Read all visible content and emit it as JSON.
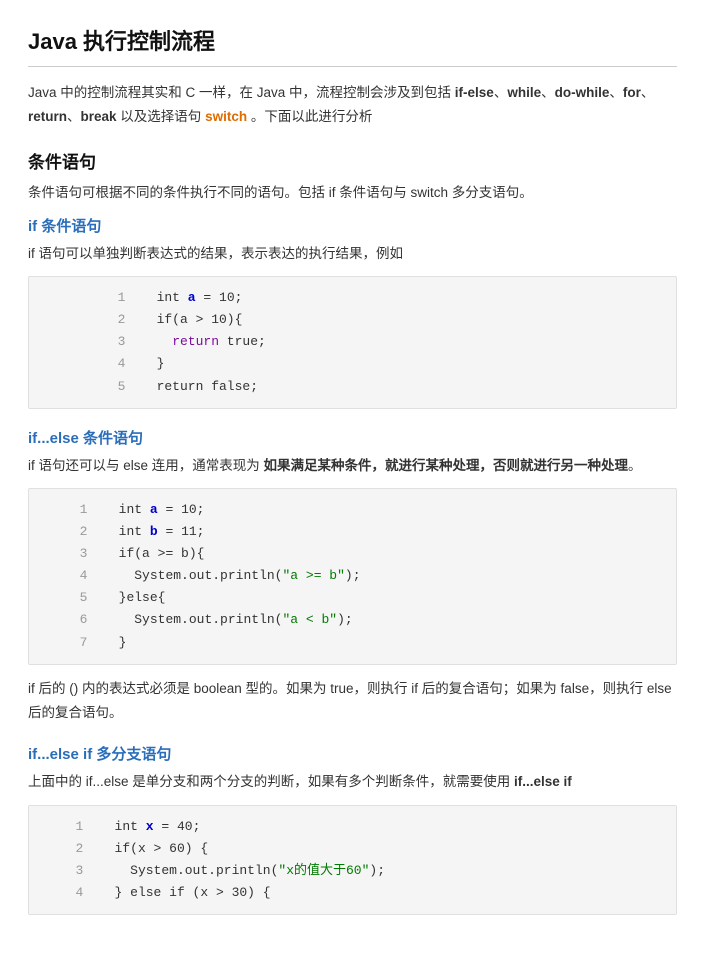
{
  "page": {
    "title": "Java 执行控制流程",
    "intro": {
      "text_parts": [
        {
          "text": "Java 中的控制流程其实和 C 一样，在 Java 中，流程控制会涉及到包括 ",
          "type": "normal"
        },
        {
          "text": "if-else",
          "type": "bold"
        },
        {
          "text": "、",
          "type": "normal"
        },
        {
          "text": "while",
          "type": "bold"
        },
        {
          "text": "、",
          "type": "normal"
        },
        {
          "text": "do-while",
          "type": "bold"
        },
        {
          "text": "、",
          "type": "normal"
        },
        {
          "text": "for",
          "type": "bold"
        },
        {
          "text": "、",
          "type": "normal"
        },
        {
          "text": "return",
          "type": "bold"
        },
        {
          "text": "、",
          "type": "normal"
        },
        {
          "text": "break",
          "type": "bold"
        },
        {
          "text": " 以及选择语句 ",
          "type": "normal"
        },
        {
          "text": "switch",
          "type": "switch"
        },
        {
          "text": " 。下面以此进行分析",
          "type": "normal"
        }
      ]
    },
    "sections": [
      {
        "id": "conditional",
        "h2": "条件语句",
        "desc": "条件语句可根据不同的条件执行不同的语句。包括 if 条件语句与 switch 多分支语句。",
        "subsections": [
          {
            "id": "if",
            "h3": "if 条件语句",
            "desc": "if 语句可以单独判断表达式的结果，表示表达的执行结果，例如",
            "code": {
              "lines": [
                {
                  "num": 1,
                  "parts": [
                    {
                      "text": "    int ",
                      "cls": ""
                    },
                    {
                      "text": "a",
                      "cls": "kw-blue"
                    },
                    {
                      "text": " = 10;",
                      "cls": ""
                    }
                  ]
                },
                {
                  "num": 2,
                  "parts": [
                    {
                      "text": "    if(a > 10){",
                      "cls": ""
                    }
                  ]
                },
                {
                  "num": 3,
                  "parts": [
                    {
                      "text": "      ",
                      "cls": ""
                    },
                    {
                      "text": "return",
                      "cls": "kw-purple"
                    },
                    {
                      "text": " true;",
                      "cls": ""
                    }
                  ]
                },
                {
                  "num": 4,
                  "parts": [
                    {
                      "text": "    }",
                      "cls": ""
                    }
                  ]
                },
                {
                  "num": 5,
                  "parts": [
                    {
                      "text": "    return false;",
                      "cls": ""
                    }
                  ]
                }
              ]
            }
          },
          {
            "id": "if-else",
            "h3": "if...else 条件语句",
            "desc_parts": [
              {
                "text": "if 语句还可以与 else 连用，通常表现为 ",
                "cls": ""
              },
              {
                "text": "如果满足某种条件，就进行某种处理，否则就进行另一种处理",
                "cls": "bold"
              },
              {
                "text": "。",
                "cls": ""
              }
            ],
            "code": {
              "lines": [
                {
                  "num": 1,
                  "parts": [
                    {
                      "text": "    int ",
                      "cls": ""
                    },
                    {
                      "text": "a",
                      "cls": "kw-blue"
                    },
                    {
                      "text": " = 10;",
                      "cls": ""
                    }
                  ]
                },
                {
                  "num": 2,
                  "parts": [
                    {
                      "text": "    int ",
                      "cls": ""
                    },
                    {
                      "text": "b",
                      "cls": "kw-blue"
                    },
                    {
                      "text": " = 11;",
                      "cls": ""
                    }
                  ]
                },
                {
                  "num": 3,
                  "parts": [
                    {
                      "text": "    if(a >= b){",
                      "cls": ""
                    }
                  ]
                },
                {
                  "num": 4,
                  "parts": [
                    {
                      "text": "      System.out.println(",
                      "cls": ""
                    },
                    {
                      "text": "\"a >= b\"",
                      "cls": "str-green"
                    },
                    {
                      "text": ");",
                      "cls": ""
                    }
                  ]
                },
                {
                  "num": 5,
                  "parts": [
                    {
                      "text": "    }else{",
                      "cls": ""
                    }
                  ]
                },
                {
                  "num": 6,
                  "parts": [
                    {
                      "text": "      System.out.println(",
                      "cls": ""
                    },
                    {
                      "text": "\"a < b\"",
                      "cls": "str-green"
                    },
                    {
                      "text": ");",
                      "cls": ""
                    }
                  ]
                },
                {
                  "num": 7,
                  "parts": [
                    {
                      "text": "    }",
                      "cls": ""
                    }
                  ]
                }
              ]
            },
            "bottom_text_parts": [
              {
                "text": "if 后的 () 内的表达式必须是 boolean 型的。如果为 true，则执行 if 后的复合语句；如果为 false，则执行 else 后的复合语句。",
                "cls": ""
              }
            ]
          },
          {
            "id": "if-else-if",
            "h3": "if...else if 多分支语句",
            "desc": "上面中的 if...else 是单分支和两个分支的判断，如果有多个判断条件，就需要使用 if...else if",
            "desc_bold": "if...else if",
            "code": {
              "lines": [
                {
                  "num": 1,
                  "parts": [
                    {
                      "text": "    int ",
                      "cls": ""
                    },
                    {
                      "text": "x",
                      "cls": "kw-blue"
                    },
                    {
                      "text": " = 40;",
                      "cls": ""
                    }
                  ]
                },
                {
                  "num": 2,
                  "parts": [
                    {
                      "text": "    if(x > 60) {",
                      "cls": ""
                    }
                  ]
                },
                {
                  "num": 3,
                  "parts": [
                    {
                      "text": "      System.out.println(",
                      "cls": ""
                    },
                    {
                      "text": "\"x的值大于60\"",
                      "cls": "str-green"
                    },
                    {
                      "text": ");",
                      "cls": ""
                    }
                  ]
                },
                {
                  "num": 4,
                  "parts": [
                    {
                      "text": "    } else if (x > 30) {",
                      "cls": ""
                    }
                  ]
                }
              ]
            }
          }
        ]
      }
    ]
  }
}
